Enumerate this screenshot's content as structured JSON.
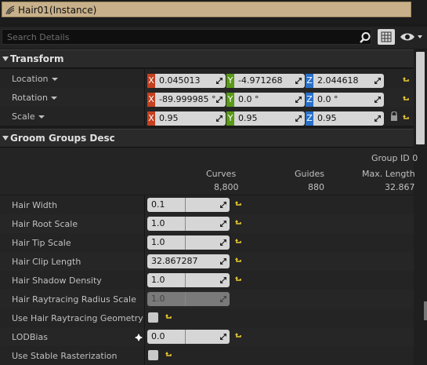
{
  "object": {
    "name": "Hair01(Instance)"
  },
  "search": {
    "placeholder": "Search Details"
  },
  "sections": {
    "transform": "Transform",
    "groom": "Groom Groups Desc"
  },
  "transform": {
    "location": {
      "label": "Location",
      "x": "0.045013",
      "y": "-4.971268",
      "z": "2.044618"
    },
    "rotation": {
      "label": "Rotation",
      "x": "-89.999985 °",
      "y": "0.0 °",
      "z": "0.0 °"
    },
    "scale": {
      "label": "Scale",
      "x": "0.95",
      "y": "0.95",
      "z": "0.95"
    },
    "axes": {
      "x": "X",
      "y": "Y",
      "z": "Z"
    }
  },
  "groom": {
    "group_id": "Group ID 0",
    "columns": [
      {
        "header": "Curves",
        "value": "8,800"
      },
      {
        "header": "Guides",
        "value": "880"
      },
      {
        "header": "Max. Length",
        "value": "32.867"
      }
    ],
    "properties": [
      {
        "label": "Hair Width",
        "value": "0.1"
      },
      {
        "label": "Hair Root Scale",
        "value": "1.0"
      },
      {
        "label": "Hair Tip Scale",
        "value": "1.0"
      },
      {
        "label": "Hair Clip Length",
        "value": "32.867287"
      },
      {
        "label": "Hair Shadow Density",
        "value": "1.0"
      },
      {
        "label": "Hair Raytracing Radius Scale",
        "value": "1.0"
      },
      {
        "label": "Use Hair Raytracing Geometry",
        "value": ""
      },
      {
        "label": "LODBias",
        "value": "0.0"
      },
      {
        "label": "Use Stable Rasterization",
        "value": ""
      }
    ]
  },
  "colors": {
    "x_axis": "#c44020",
    "y_axis": "#5a9a18",
    "z_axis": "#2a70c8",
    "reset_arrow": "#e8c830",
    "name_field": "#c7b08a"
  }
}
